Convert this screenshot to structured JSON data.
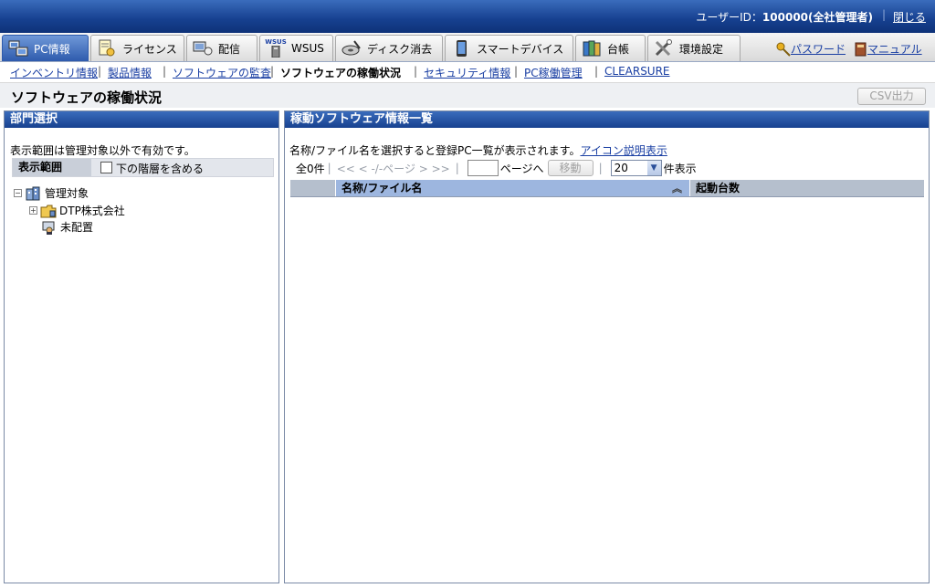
{
  "header": {
    "user_prefix": "ユーザーID：",
    "user_id": "100000(全社管理者)",
    "close_label": "閉じる"
  },
  "tabs": [
    {
      "label": "PC情報",
      "icon": "pc-icon"
    },
    {
      "label": "ライセンス",
      "icon": "license-icon"
    },
    {
      "label": "配信",
      "icon": "delivery-icon"
    },
    {
      "label": "WSUS",
      "icon": "wsus-icon"
    },
    {
      "label": "ディスク消去",
      "icon": "disk-erase-icon"
    },
    {
      "label": "スマートデバイス",
      "icon": "smart-device-icon"
    },
    {
      "label": "台帳",
      "icon": "ledger-icon"
    },
    {
      "label": "環境設定",
      "icon": "settings-tools-icon"
    }
  ],
  "header_links": {
    "password": "パスワード",
    "manual": "マニュアル",
    "wsus_badge": "WSUS"
  },
  "subnav": [
    "インベントリ情報",
    "製品情報",
    "ソフトウェアの監査",
    "ソフトウェアの稼働状況",
    "セキュリティ情報",
    "PC稼働管理",
    "CLEARSURE"
  ],
  "page": {
    "title": "ソフトウェアの稼働状況",
    "csv_button": "CSV出力"
  },
  "left_panel": {
    "title": "部門選択",
    "note": "表示範囲は管理対象以外で有効です。",
    "scope_label": "表示範囲",
    "include_children": "下の階層を含める",
    "tree": {
      "root": "管理対象",
      "company": "DTP株式会社",
      "unassigned": "未配置"
    }
  },
  "right_panel": {
    "title": "稼動ソフトウェア情報一覧",
    "note": "名称/ファイル名を選択すると登録PC一覧が表示されます。",
    "icon_help_link": "アイコン説明表示",
    "total": "全0件",
    "pager_nav": "<< < -/-ページ > >>",
    "page_suffix": "ページへ",
    "move_button": "移動",
    "per_page_value": "20",
    "per_page_suffix": "件表示",
    "columns": [
      "名称/ファイル名",
      "起動台数"
    ],
    "rows": []
  }
}
